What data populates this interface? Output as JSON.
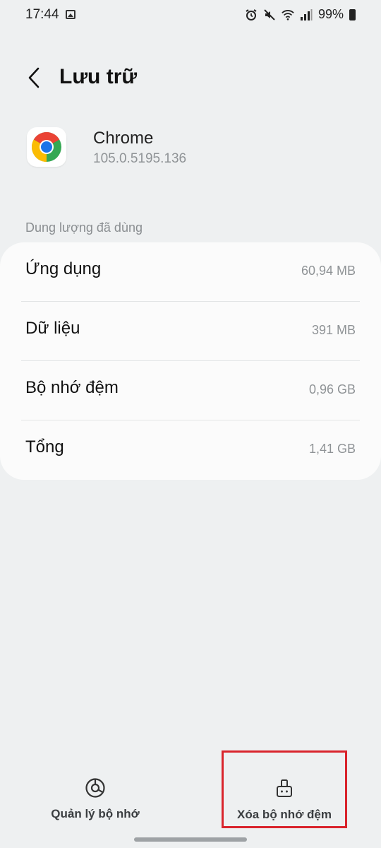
{
  "status_bar": {
    "time": "17:44",
    "battery": "99%",
    "icons": [
      "gallery-icon",
      "alarm-icon",
      "mute-icon",
      "wifi-icon",
      "signal-icon",
      "battery-icon"
    ]
  },
  "header": {
    "title": "Lưu trữ"
  },
  "app": {
    "name": "Chrome",
    "version": "105.0.5195.136"
  },
  "storage": {
    "section_label": "Dung lượng đã dùng",
    "rows": [
      {
        "label": "Ứng dụng",
        "value": "60,94 MB"
      },
      {
        "label": "Dữ liệu",
        "value": "391 MB"
      },
      {
        "label": "Bộ nhớ đệm",
        "value": "0,96 GB"
      },
      {
        "label": "Tổng",
        "value": "1,41 GB"
      }
    ]
  },
  "bottom_nav": {
    "manage_storage": "Quản lý bộ nhớ",
    "clear_cache": "Xóa bộ nhớ đệm"
  },
  "colors": {
    "background": "#eef0f1",
    "card": "#fbfbfb",
    "highlight_border": "#d9242c"
  }
}
